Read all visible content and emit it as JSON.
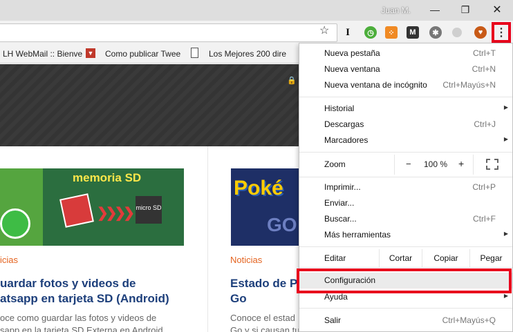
{
  "window": {
    "profile_name": "Juan M.",
    "minimize_glyph": "—",
    "maximize_glyph": "❐",
    "close_glyph": "✕"
  },
  "toolbar": {
    "star_glyph": "☆",
    "ext_i": "I",
    "ext_green": "◷",
    "ext_rss": "⁘",
    "ext_m": "M",
    "ext_gear": "✱",
    "ext_orange": "♥",
    "menu_glyph": "⋮"
  },
  "bookmarks": [
    {
      "label": "LH WebMail :: Bienve"
    },
    {
      "label": "Como publicar Twee"
    },
    {
      "label": "Los Mejores 200 dire"
    }
  ],
  "page": {
    "lock_glyph": "🔒",
    "article1": {
      "image_title": "memoria SD",
      "sd_label": "micro SD",
      "category": "icias",
      "heading_line1": "uardar fotos y videos de",
      "heading_line2": "atsapp en tarjeta SD (Android)",
      "excerpt_line1": "oce como guardar las fotos y videos de",
      "excerpt_line2": "sapp en la tarjeta SD Externa en Android"
    },
    "article2": {
      "image_text1": "Poké",
      "image_text2": "GO",
      "category": "Noticias",
      "heading_line1": "Estado de P",
      "heading_line2": "Go",
      "excerpt_line1": "Conoce el estad",
      "excerpt_line2": "Go y si causan tus problemas"
    }
  },
  "menu": {
    "new_tab": {
      "label": "Nueva pestaña",
      "shortcut": "Ctrl+T"
    },
    "new_window": {
      "label": "Nueva ventana",
      "shortcut": "Ctrl+N"
    },
    "incognito": {
      "label": "Nueva ventana de incógnito",
      "shortcut": "Ctrl+Mayús+N"
    },
    "history": {
      "label": "Historial"
    },
    "downloads": {
      "label": "Descargas",
      "shortcut": "Ctrl+J"
    },
    "bookmarks": {
      "label": "Marcadores"
    },
    "zoom": {
      "label": "Zoom",
      "minus": "−",
      "value": "100 %",
      "plus": "+"
    },
    "print": {
      "label": "Imprimir...",
      "shortcut": "Ctrl+P"
    },
    "cast": {
      "label": "Enviar..."
    },
    "find": {
      "label": "Buscar...",
      "shortcut": "Ctrl+F"
    },
    "more_tools": {
      "label": "Más herramientas"
    },
    "edit": {
      "label": "Editar",
      "cut": "Cortar",
      "copy": "Copiar",
      "paste": "Pegar"
    },
    "settings": {
      "label": "Configuración"
    },
    "help": {
      "label": "Ayuda"
    },
    "exit": {
      "label": "Salir",
      "shortcut": "Ctrl+Mayús+Q"
    },
    "submenu_arrow": "▶"
  },
  "colors": {
    "highlight_border": "#e8001c",
    "category_color": "#e4631f",
    "heading_color": "#1d3f7b"
  }
}
